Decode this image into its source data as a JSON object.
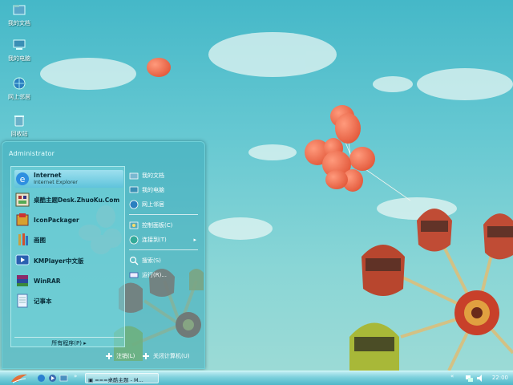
{
  "desktop": {
    "icons": [
      {
        "label": "我的文档",
        "icon": "my-documents-icon"
      },
      {
        "label": "我的电脑",
        "icon": "my-computer-icon"
      },
      {
        "label": "网上邻居",
        "icon": "network-icon"
      },
      {
        "label": "回收站",
        "icon": "recycle-bin-icon"
      }
    ]
  },
  "start_menu": {
    "user": "Administrator",
    "pinned": [
      {
        "title": "Internet",
        "subtitle": "Internet Explorer",
        "icon": "internet-explorer-icon"
      },
      {
        "title": "桌酷主题Desk.ZhuoKu.Com",
        "icon": "theme-icon"
      },
      {
        "title": "IconPackager",
        "icon": "iconpackager-icon"
      },
      {
        "title": "画图",
        "icon": "paint-icon"
      },
      {
        "title": "KMPlayer中文版",
        "icon": "kmplayer-icon"
      },
      {
        "title": "WinRAR",
        "icon": "winrar-icon"
      },
      {
        "title": "记事本",
        "icon": "notepad-icon"
      }
    ],
    "all_programs": "所有程序(P)",
    "right_items": [
      {
        "label": "我的文档",
        "icon": "folder-icon"
      },
      {
        "label": "我的电脑",
        "icon": "computer-icon"
      },
      {
        "label": "网上邻居",
        "icon": "network-icon"
      },
      {
        "label": "控制面板(C)",
        "icon": "control-panel-icon"
      },
      {
        "label": "连接到(T)",
        "icon": "connect-icon",
        "submenu": true
      },
      {
        "label": "搜索(S)",
        "icon": "search-icon"
      },
      {
        "label": "运行(R)...",
        "icon": "run-icon"
      }
    ],
    "logoff": "注销(L)",
    "shutdown": "关闭计算机(U)"
  },
  "taskbar": {
    "task_label": "===桌酷主题 - M...",
    "clock": "22:00"
  },
  "colors": {
    "balloon": "#ee6a4e",
    "sky": "#5cc4cf"
  }
}
